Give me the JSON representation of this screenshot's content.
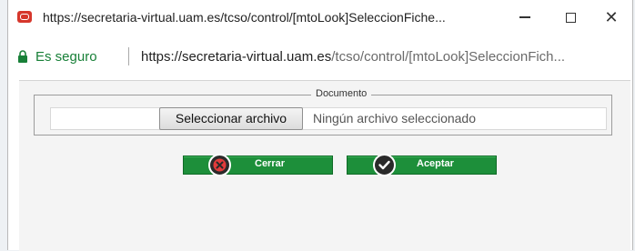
{
  "window": {
    "title": "https://secretaria-virtual.uam.es/tcso/control/[mtoLook]SeleccionFiche...",
    "minimize_label": "—",
    "close_label": "✕"
  },
  "address_bar": {
    "secure_label": "Es seguro",
    "url_host": "https://secretaria-virtual.uam.es",
    "url_path": "/tcso/control/[mtoLook]SeleccionFich..."
  },
  "form": {
    "legend": "Documento",
    "file_button_label": "Seleccionar archivo",
    "file_status": "Ningún archivo seleccionado"
  },
  "actions": {
    "close_label": "Cerrar",
    "accept_label": "Aceptar"
  },
  "colors": {
    "button_green": "#1d8f3a",
    "secure_green": "#188038",
    "close_icon_red": "#e23b3b"
  },
  "icons": {
    "app": "browser-app-icon",
    "lock": "lock-icon",
    "close_action": "close-x-icon",
    "accept_action": "checkmark-icon"
  }
}
